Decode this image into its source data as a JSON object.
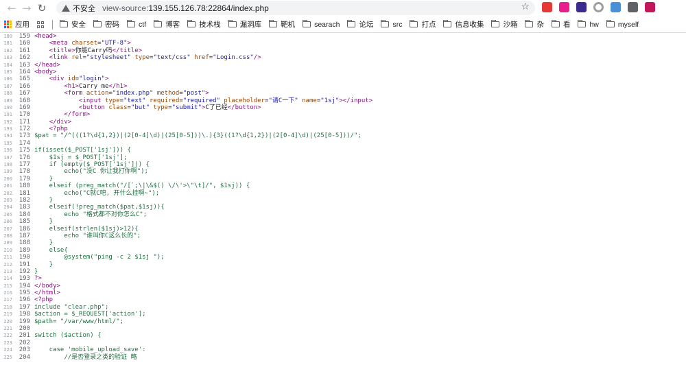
{
  "toolbar": {
    "security_label": "不安全",
    "url_scheme": "view-source:",
    "url_rest": "139.155.126.78:22864/index.php",
    "icons": [
      "back-icon",
      "forward-icon",
      "reload-icon",
      "warning-icon",
      "star-icon"
    ]
  },
  "bookmarks": {
    "apps_label": "应用",
    "items": [
      "安全",
      "密码",
      "ctf",
      "博客",
      "技术栈",
      "漏洞库",
      "靶机",
      "searach",
      "论坛",
      "src",
      "打点",
      "信息收集",
      "沙箱",
      "杂",
      "看",
      "hw",
      "myself"
    ]
  },
  "extensions": {
    "colors": [
      "#e53935",
      "#e91e8c",
      "#3b2c8f",
      "#9e9e9e",
      "#4a90d9",
      "#5f6368",
      "#c2185b"
    ]
  },
  "source_lines": [
    {
      "o": "180",
      "n": "159",
      "t": "<head>"
    },
    {
      "o": "181",
      "n": "160",
      "t": "    <meta charset=\"UTF-8\">"
    },
    {
      "o": "182",
      "n": "161",
      "t": "    <title>你能Carry吗</title>"
    },
    {
      "o": "183",
      "n": "162",
      "t": "    <link rel=\"stylesheet\" type=\"text/css\" href=\"Login.css\"/>"
    },
    {
      "o": "184",
      "n": "163",
      "t": "</head>"
    },
    {
      "o": "185",
      "n": "164",
      "t": "<body>"
    },
    {
      "o": "186",
      "n": "165",
      "t": "    <div id=\"login\">"
    },
    {
      "o": "187",
      "n": "166",
      "t": "        <h1>Carry me</h1>"
    },
    {
      "o": "188",
      "n": "167",
      "t": "        <form action=\"index.php\" method=\"post\">"
    },
    {
      "o": "189",
      "n": "168",
      "t": "            <input type=\"text\" required=\"required\" placeholder=\"请C一下\" name=\"1sj\"></input>"
    },
    {
      "o": "190",
      "n": "169",
      "t": "            <button class=\"but\" type=\"submit\">C了已经</button>"
    },
    {
      "o": "191",
      "n": "170",
      "t": "        </form>"
    },
    {
      "o": "192",
      "n": "171",
      "t": "    </div>"
    },
    {
      "o": "193",
      "n": "172",
      "t": "    <?php"
    },
    {
      "o": "194",
      "n": "173",
      "t": "$pat = \"/^(((1?\\d{1,2})|(2[0-4]\\d)|(25[0-5]))\\.){3}((1?\\d{1,2})|(2[0-4]\\d)|(25[0-5]))/\";"
    },
    {
      "o": "195",
      "n": "174",
      "t": ""
    },
    {
      "o": "196",
      "n": "175",
      "t": "if(isset($_POST['1sj'])) {"
    },
    {
      "o": "197",
      "n": "176",
      "t": "    $1sj = $_POST['1sj'];"
    },
    {
      "o": "198",
      "n": "177",
      "t": "    if (empty($_POST['1sj'])) {"
    },
    {
      "o": "199",
      "n": "178",
      "t": "        echo(\"没C 你让我打你啊\");"
    },
    {
      "o": "200",
      "n": "179",
      "t": "    }"
    },
    {
      "o": "201",
      "n": "180",
      "t": "    elseif (preg_match(\"/[`;\\|\\&$() \\/\\'>\\\"\\t]/\", $1sj)) {"
    },
    {
      "o": "202",
      "n": "181",
      "t": "        echo(\"C就C吧, 开什么挂啊~\");"
    },
    {
      "o": "203",
      "n": "182",
      "t": "    }"
    },
    {
      "o": "204",
      "n": "183",
      "t": "    elseif(!preg_match($pat,$1sj)){"
    },
    {
      "o": "205",
      "n": "184",
      "t": "        echo \"格式都不对你怎么C\";"
    },
    {
      "o": "206",
      "n": "185",
      "t": "    }"
    },
    {
      "o": "207",
      "n": "186",
      "t": "    elseif(strlen($1sj)>12){"
    },
    {
      "o": "208",
      "n": "187",
      "t": "        echo \"谁叫你C这么长的\";"
    },
    {
      "o": "209",
      "n": "188",
      "t": "    }"
    },
    {
      "o": "210",
      "n": "189",
      "t": "    else{"
    },
    {
      "o": "211",
      "n": "190",
      "t": "        @system(\"ping -c 2 $1sj \");"
    },
    {
      "o": "212",
      "n": "191",
      "t": "    }"
    },
    {
      "o": "213",
      "n": "192",
      "t": "}"
    },
    {
      "o": "214",
      "n": "193",
      "t": "?>"
    },
    {
      "o": "215",
      "n": "194",
      "t": "</body>"
    },
    {
      "o": "216",
      "n": "195",
      "t": "</html>"
    },
    {
      "o": "217",
      "n": "196",
      "t": "<?php"
    },
    {
      "o": "218",
      "n": "197",
      "t": "include \"clear.php\";"
    },
    {
      "o": "219",
      "n": "198",
      "t": "$action = $_REQUEST['action'];"
    },
    {
      "o": "220",
      "n": "199",
      "t": "$path= \"/var/www/html/\";"
    },
    {
      "o": "221",
      "n": "200",
      "t": ""
    },
    {
      "o": "222",
      "n": "201",
      "t": "switch ($action) {"
    },
    {
      "o": "223",
      "n": "202",
      "t": ""
    },
    {
      "o": "224",
      "n": "203",
      "t": "    case 'mobile_upload_save':"
    },
    {
      "o": "225",
      "n": "204",
      "t": "        //是否登录之类的验证 略"
    }
  ]
}
